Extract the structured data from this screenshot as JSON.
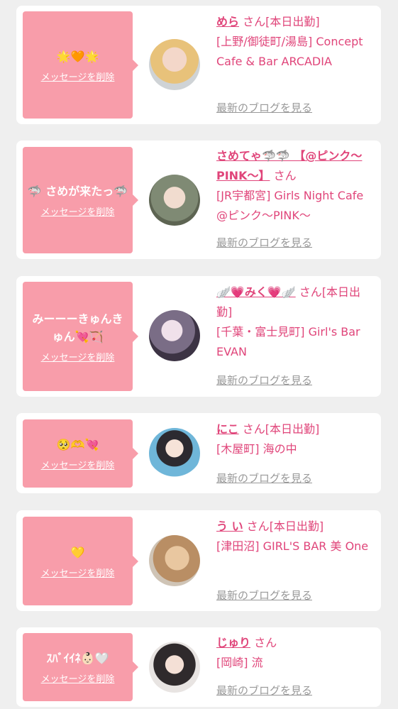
{
  "entries": [
    {
      "message": "🌟🧡🌟",
      "delete_label": "メッセージを削除",
      "name": "めら",
      "san": "さん",
      "status": "[本日出勤]",
      "shop": "[上野/御徒町/湯島] Concept Cafe & Bar ARCADIA",
      "blog_label": "最新のブログを見る"
    },
    {
      "message": "🦈 さめが来たっ🦈",
      "delete_label": "メッセージを削除",
      "name": "さめてゃ🦈🦈 【@ピンク〜PINK〜】",
      "san": "さん",
      "status": "",
      "shop": "[JR宇都宮] Girls Night Cafe @ピンク〜PINK〜",
      "blog_label": "最新のブログを見る"
    },
    {
      "message": "みーーーきゅんきゅん💘🏹",
      "delete_label": "メッセージを削除",
      "name": "🪽💗みく💗🪽",
      "san": "さん",
      "status": "[本日出勤]",
      "shop": "[千葉・富士見町] Girl's Bar EVAN",
      "blog_label": "最新のブログを見る"
    },
    {
      "message": "🥺🫶💘",
      "delete_label": "メッセージを削除",
      "name": "にこ",
      "san": "さん",
      "status": "[本日出勤]",
      "shop": "[木屋町] 海の中",
      "blog_label": "最新のブログを見る"
    },
    {
      "message": "💛",
      "delete_label": "メッセージを削除",
      "name": "う い",
      "san": "さん",
      "status": "[本日出勤]",
      "shop": "[津田沼] GIRL'S BAR 美 One",
      "blog_label": "最新のブログを見る"
    },
    {
      "message": "ｽﾊﾞｲｲﾈ👶🏻🤍",
      "delete_label": "メッセージを削除",
      "name": "じゅり",
      "san": "さん",
      "status": "",
      "shop": "[岡崎] 流",
      "blog_label": "最新のブログを見る"
    }
  ],
  "colors": {
    "accent": "#e0457a",
    "message_bg": "#f89daa",
    "page_bg": "#efefef",
    "link_gray": "#999999"
  }
}
